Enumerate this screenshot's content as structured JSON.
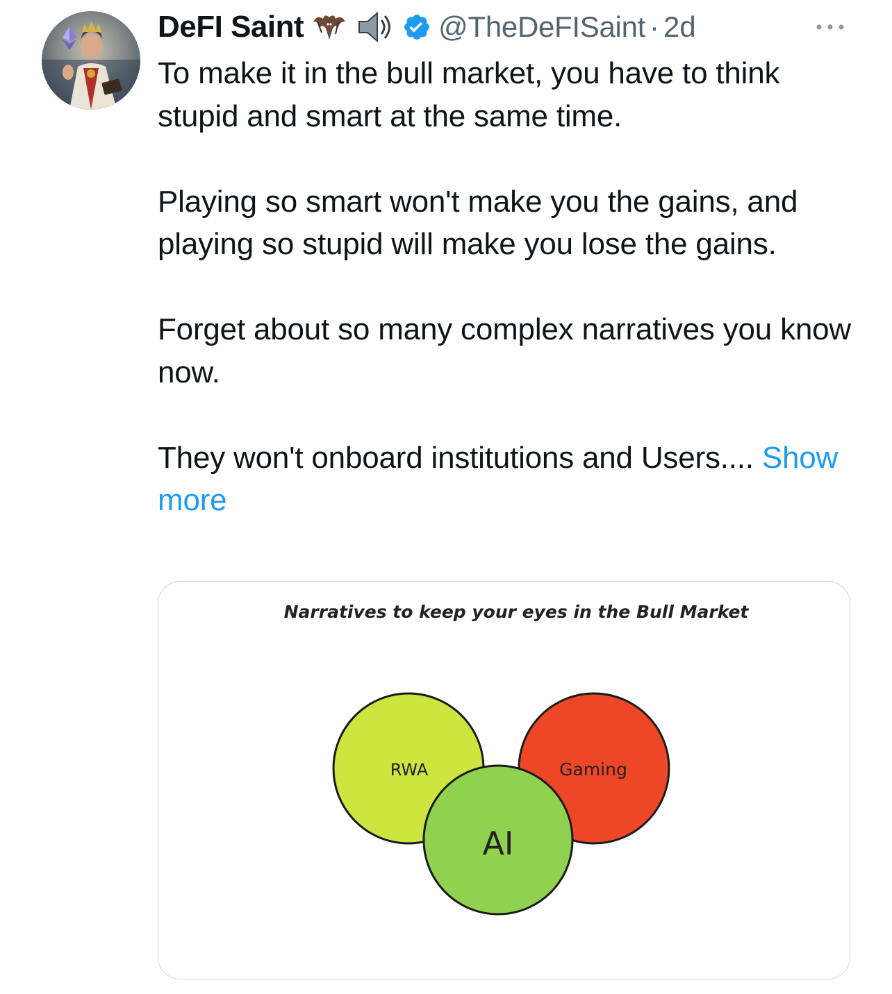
{
  "tweet": {
    "author": {
      "display_name": "DeFI Saint",
      "name_emojis": [
        "bat-emoji",
        "speaker-emoji"
      ],
      "verified": true,
      "handle": "@TheDeFISaint",
      "separator": "·",
      "time_ago": "2d",
      "avatar": "saint-with-ethereum-logo-avatar"
    },
    "paragraphs": [
      "To make it in the bull market, you have to think stupid and smart at the same time.",
      "Playing so smart won't make you the gains, and playing so stupid will make you lose the gains.",
      "Forget about so many complex narratives you know now."
    ],
    "last_paragraph": "They won't onboard institutions and Users....",
    "show_more": "Show more",
    "more_menu_icon": "more-horizontal-icon",
    "colors": {
      "text": "#0f1419",
      "secondary": "#536471",
      "link": "#1d9bf0",
      "verified": "#1d9bf0",
      "card_border": "#cfd9de"
    }
  },
  "media": {
    "title": "Narratives to keep your eyes in the Bull Market",
    "circles": [
      {
        "label": "RWA",
        "color": "#cde53e"
      },
      {
        "label": "Gaming",
        "color": "#ee4728"
      },
      {
        "label": "AI",
        "color": "#90d14f"
      }
    ]
  }
}
